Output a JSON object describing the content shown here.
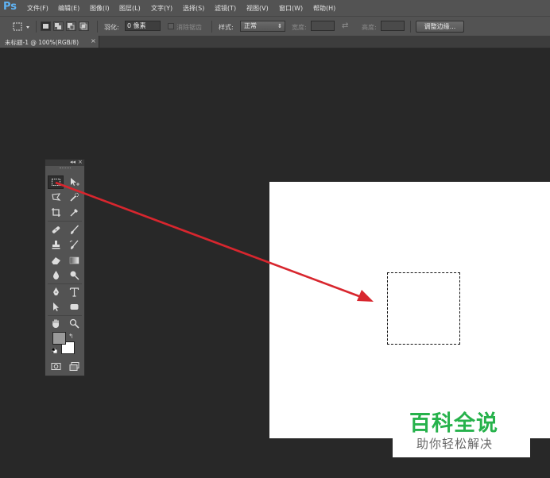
{
  "app": {
    "logo": "Ps"
  },
  "menu": {
    "items": [
      "文件(F)",
      "编辑(E)",
      "图像(I)",
      "图层(L)",
      "文字(Y)",
      "选择(S)",
      "滤镜(T)",
      "视图(V)",
      "窗口(W)",
      "帮助(H)"
    ]
  },
  "options_bar": {
    "feather_label": "羽化:",
    "feather_value": "0 像素",
    "antialias_label": "消除锯齿",
    "style_label": "样式:",
    "style_value": "正常",
    "width_label": "宽度:",
    "height_label": "高度:",
    "refine_edge_label": "调整边缘..."
  },
  "document_tab": {
    "label": "未标题-1 @ 100%(RGB/8)",
    "close": "×"
  },
  "tools_panel": {
    "collapse_glyph": "◂◂",
    "close_glyph": "×",
    "tools": [
      "rectangular-marquee",
      "move",
      "lasso",
      "quick-selection",
      "crop",
      "eyedropper",
      "spot-healing",
      "brush",
      "clone-stamp",
      "history-brush",
      "eraser",
      "gradient",
      "blur",
      "dodge",
      "pen",
      "horizontal-type",
      "path-selection",
      "rectangle",
      "hand",
      "zoom"
    ],
    "foreground_color": "#9a9a9a",
    "background_color": "#ffffff"
  },
  "annotation": {
    "arrow_color": "#d8262e"
  },
  "watermark": {
    "title": "百科全说",
    "subtitle": "助你轻松解决",
    "title_color": "#26b24b"
  }
}
